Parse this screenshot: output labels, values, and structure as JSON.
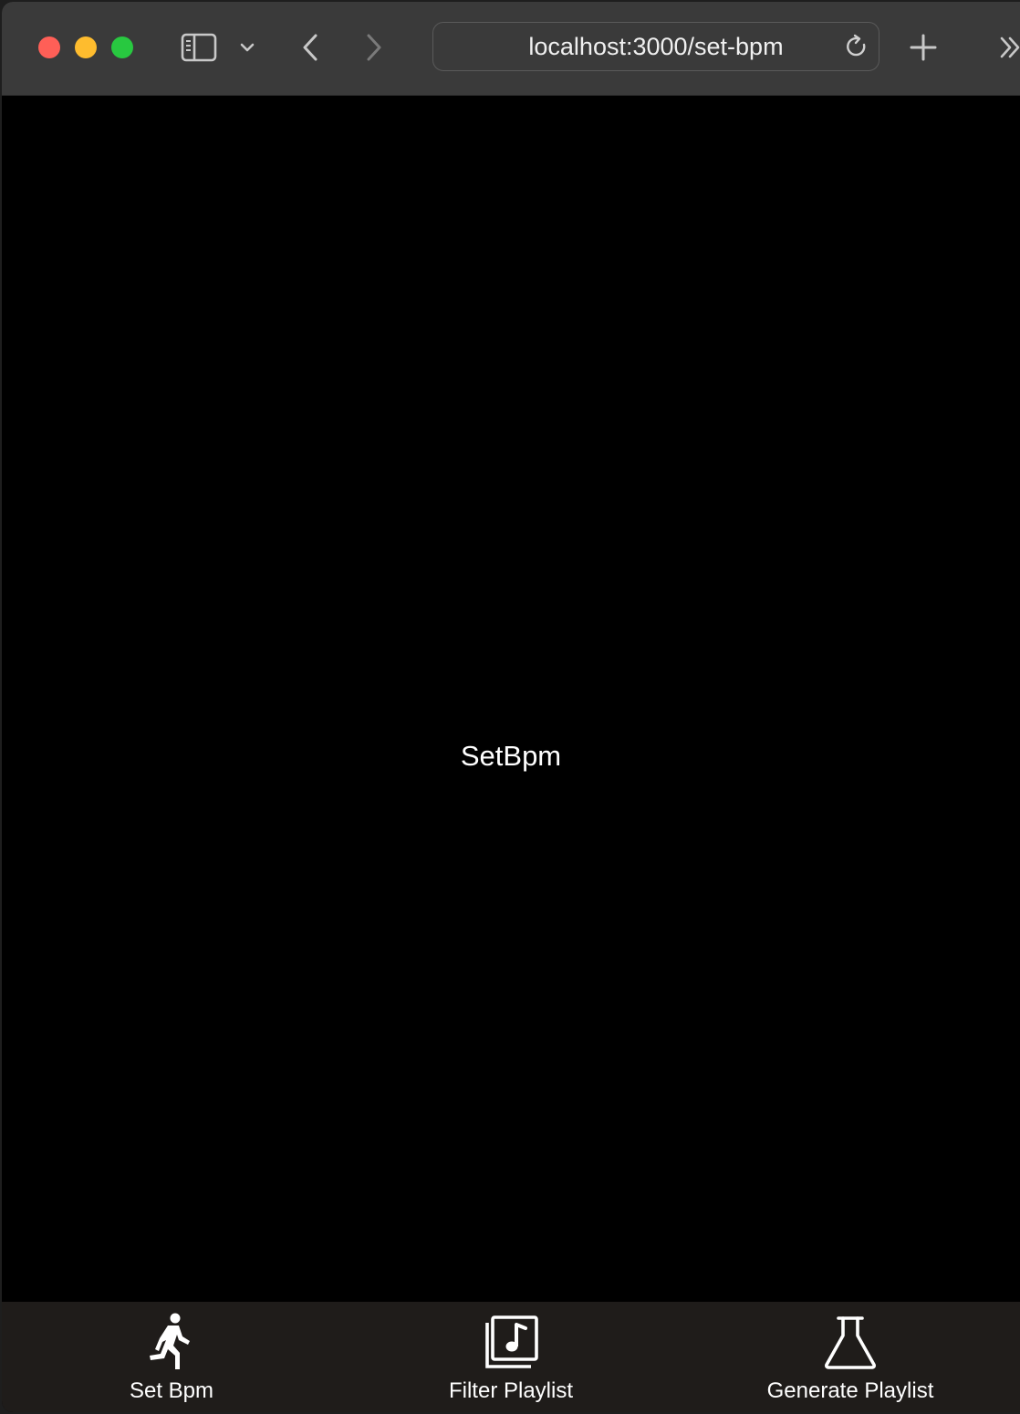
{
  "browser": {
    "url": "localhost:3000/set-bpm",
    "icons": {
      "close": "close-window-dot",
      "minimize": "minimize-window-dot",
      "zoom": "zoom-window-dot",
      "sidebar": "sidebar-icon",
      "sidebar_menu": "chevron-down-icon",
      "back": "chevron-left-icon",
      "forward": "chevron-right-icon",
      "reload": "reload-icon",
      "new_tab": "plus-icon",
      "overflow": "double-chevron-right-icon"
    },
    "colors": {
      "close": "#ff5f57",
      "minimize": "#febc2e",
      "zoom": "#28c840",
      "toolbar": "#3a3a3a"
    }
  },
  "page": {
    "heading": "SetBpm",
    "background": "#000000"
  },
  "tabbar": {
    "background": "#1f1c1a",
    "tabs": [
      {
        "label": "Set Bpm",
        "icon": "running-figure-icon"
      },
      {
        "label": "Filter Playlist",
        "icon": "music-library-icon"
      },
      {
        "label": "Generate Playlist",
        "icon": "flask-icon"
      }
    ]
  }
}
